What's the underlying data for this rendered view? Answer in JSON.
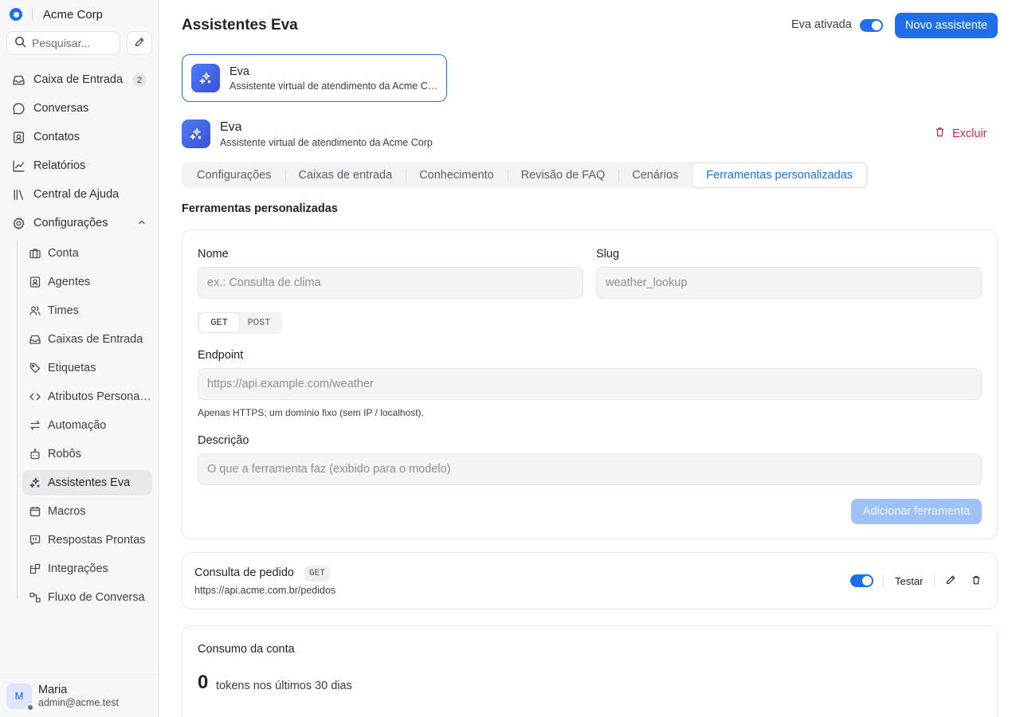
{
  "brand": {
    "name": "Acme Corp"
  },
  "search": {
    "placeholder": "Pesquisar..."
  },
  "nav": {
    "inbox": {
      "label": "Caixa de Entrada",
      "badge": "2"
    },
    "conversations": {
      "label": "Conversas"
    },
    "contacts": {
      "label": "Contatos"
    },
    "reports": {
      "label": "Relatórios"
    },
    "help_center": {
      "label": "Central de Ajuda"
    },
    "settings": {
      "label": "Configurações"
    },
    "settings_items": [
      {
        "label": "Conta",
        "icon": "briefcase-icon"
      },
      {
        "label": "Agentes",
        "icon": "contact-card-icon"
      },
      {
        "label": "Times",
        "icon": "users-icon"
      },
      {
        "label": "Caixas de Entrada",
        "icon": "inbox-icon"
      },
      {
        "label": "Etiquetas",
        "icon": "tag-icon"
      },
      {
        "label": "Atributos Personalizados",
        "icon": "code-icon"
      },
      {
        "label": "Automação",
        "icon": "arrows-icon"
      },
      {
        "label": "Robôs",
        "icon": "bot-icon"
      },
      {
        "label": "Assistentes Eva",
        "icon": "sparkles-icon"
      },
      {
        "label": "Macros",
        "icon": "calendar-icon"
      },
      {
        "label": "Respostas Prontas",
        "icon": "message-quote-icon"
      },
      {
        "label": "Integrações",
        "icon": "blocks-icon"
      },
      {
        "label": "Fluxo de Conversa",
        "icon": "flow-icon"
      }
    ]
  },
  "user": {
    "initial": "M",
    "name": "Maria",
    "email": "admin@acme.test"
  },
  "header": {
    "title": "Assistentes Eva",
    "toggle_label": "Eva ativada",
    "toggle_on": true,
    "new_button": "Novo assistente"
  },
  "assistant_card": {
    "name": "Eva",
    "description": "Assistente virtual de atendimento da Acme Corp"
  },
  "detail": {
    "name": "Eva",
    "description": "Assistente virtual de atendimento da Acme Corp",
    "delete_label": "Excluir"
  },
  "tabs": [
    {
      "label": "Configurações",
      "active": false
    },
    {
      "label": "Caixas de entrada",
      "active": false
    },
    {
      "label": "Conhecimento",
      "active": false
    },
    {
      "label": "Revisão de FAQ",
      "active": false
    },
    {
      "label": "Cenários",
      "active": false
    },
    {
      "label": "Ferramentas personalizadas",
      "active": true
    }
  ],
  "section_title": "Ferramentas personalizadas",
  "form": {
    "name_label": "Nome",
    "name_placeholder": "ex.: Consulta de clima",
    "slug_label": "Slug",
    "slug_placeholder": "weather_lookup",
    "methods": [
      "GET",
      "POST"
    ],
    "selected_method": "GET",
    "endpoint_label": "Endpoint",
    "endpoint_placeholder": "https://api.example.com/weather",
    "endpoint_hint": "Apenas HTTPS; um domínio fixo (sem IP / localhost).",
    "description_label": "Descrição",
    "description_placeholder": "O que a ferramenta faz (exibido para o modelo)",
    "submit_label": "Adicionar ferramenta"
  },
  "tools": [
    {
      "name": "Consulta de pedido",
      "method": "GET",
      "url": "https://api.acme.com.br/pedidos",
      "enabled": true,
      "test_label": "Testar"
    }
  ],
  "usage": {
    "title": "Consumo da conta",
    "value": "0",
    "label": "tokens nos últimos 30 dias"
  },
  "colors": {
    "accent": "#1f6feb",
    "danger": "#c4314b",
    "sidebar_bg": "#f7f7f8"
  }
}
